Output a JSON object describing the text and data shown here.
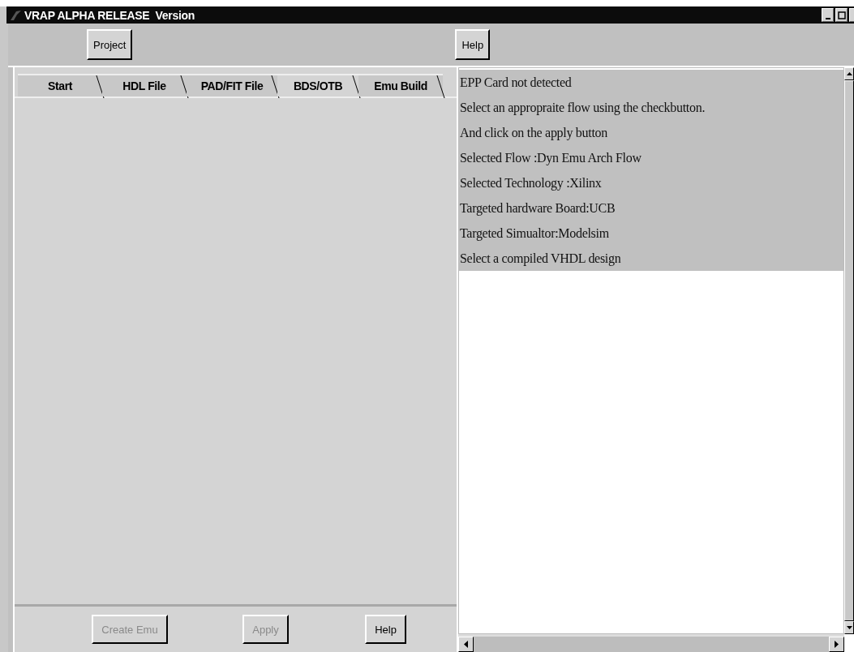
{
  "window": {
    "title": "VRAP ALPHA RELEASE  Version"
  },
  "toolbar": [
    {
      "label": "Project"
    },
    {
      "label": "Help"
    }
  ],
  "tabs": [
    {
      "label": "Start",
      "selected": false
    },
    {
      "label": "HDL File",
      "selected": false
    },
    {
      "label": "PAD/FIT File",
      "selected": false
    },
    {
      "label": "BDS/OTB",
      "selected": true
    },
    {
      "label": "Emu Build",
      "selected": false
    }
  ],
  "buttons": [
    {
      "label": "Create Emu",
      "disabled": true
    },
    {
      "label": "Apply",
      "disabled": true
    },
    {
      "label": "Help",
      "disabled": false
    }
  ],
  "log": [
    {
      "text": "EPP Card not detected",
      "selected": true
    },
    {
      "text": "Select an appropraite flow using the checkbutton.",
      "selected": true
    },
    {
      "text": "And click on the apply button",
      "selected": true
    },
    {
      "text": "Selected Flow :Dyn Emu Arch Flow",
      "selected": true
    },
    {
      "text": "Selected Technology :Xilinx",
      "selected": true
    },
    {
      "text": "Targeted hardware Board:UCB",
      "selected": true
    },
    {
      "text": "Targeted Simualtor:Modelsim",
      "selected": true
    },
    {
      "text": "Select a compiled VHDL design",
      "selected": true
    }
  ]
}
